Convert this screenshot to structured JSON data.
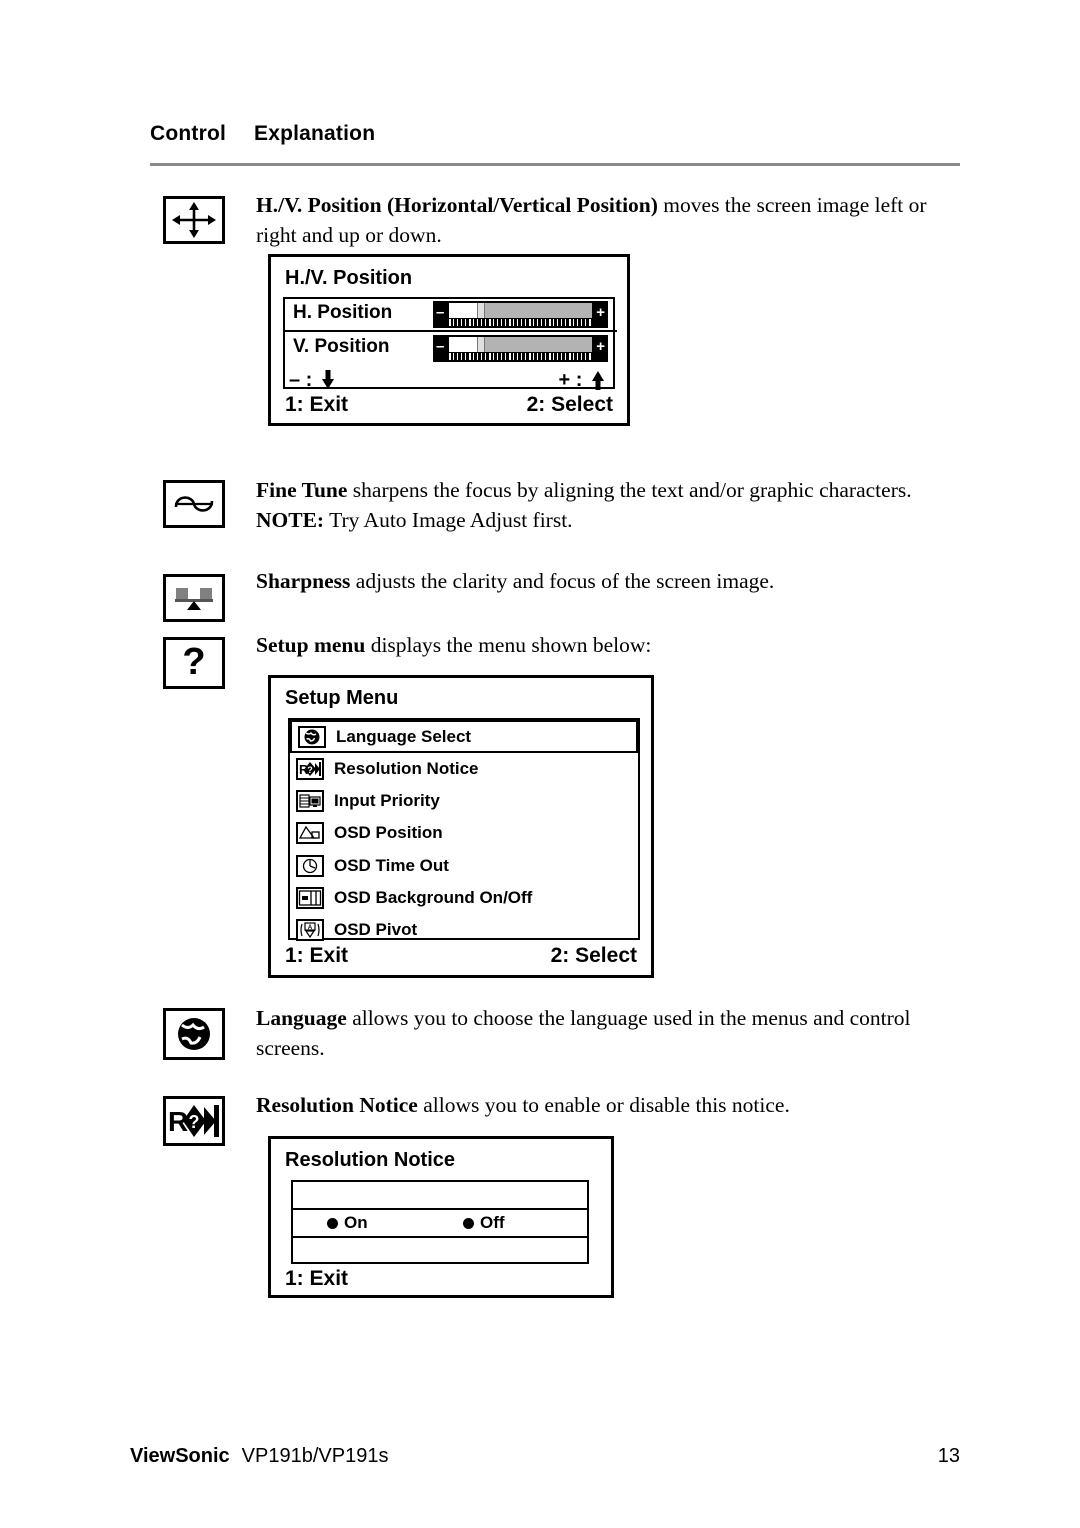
{
  "header": {
    "col_control": "Control",
    "col_explanation": "Explanation"
  },
  "controls": [
    {
      "icon": "hv-position-icon",
      "term": "H./V. Position (Horizontal/Vertical Position)",
      "description": " moves the screen image left or right and up or down."
    },
    {
      "icon": "fine-tune-icon",
      "term": "Fine Tune",
      "description": " sharpens the focus by aligning the text and/or graphic characters.",
      "note_label": "NOTE:",
      "note_text": " Try Auto Image Adjust first."
    },
    {
      "icon": "sharpness-icon",
      "term": "Sharpness",
      "description": " adjusts the clarity and focus of the screen image."
    },
    {
      "icon": "setup-menu-icon",
      "term": "Setup menu",
      "description": " displays the menu shown below:"
    },
    {
      "icon": "language-globe-icon",
      "term": "Language",
      "description": " allows you to choose the language used in the menus and control screens."
    },
    {
      "icon": "resolution-notice-icon",
      "term": "Resolution Notice",
      "description": " allows you to enable or disable this notice."
    }
  ],
  "hv_osd": {
    "title": "H./V. Position",
    "rows": [
      {
        "label": "H. Position",
        "minus": "–",
        "plus": "+",
        "fill_percent": 20,
        "thumb_percent": 20
      },
      {
        "label": "V. Position",
        "minus": "–",
        "plus": "+",
        "fill_percent": 20,
        "thumb_percent": 20
      }
    ],
    "sign_minus": "– :",
    "sign_plus": "+ :",
    "footer_left": "1: Exit",
    "footer_right": "2: Select"
  },
  "setup_osd": {
    "title": "Setup Menu",
    "items": [
      {
        "label": "Language Select",
        "icon": "globe-icon",
        "selected": true
      },
      {
        "label": "Resolution Notice",
        "icon": "resolution-notice-icon",
        "selected": false
      },
      {
        "label": "Input Priority",
        "icon": "input-priority-icon",
        "selected": false
      },
      {
        "label": "OSD Position",
        "icon": "osd-position-icon",
        "selected": false
      },
      {
        "label": "OSD Time Out",
        "icon": "clock-icon",
        "selected": false
      },
      {
        "label": "OSD Background On/Off",
        "icon": "osd-background-icon",
        "selected": false
      },
      {
        "label": "OSD Pivot",
        "icon": "osd-pivot-icon",
        "selected": false
      }
    ],
    "footer_left": "1: Exit",
    "footer_right": "2: Select"
  },
  "resolution_notice_osd": {
    "title": "Resolution Notice",
    "options": [
      {
        "label": "On"
      },
      {
        "label": "Off"
      }
    ],
    "footer_left": "1: Exit"
  },
  "footer": {
    "brand": "ViewSonic",
    "model": "VP191b/VP191s",
    "page_number": "13"
  },
  "colors": {
    "rule": "#8a8a8a",
    "slider_bg": "#000000",
    "slider_track": "#b3b3b3",
    "slider_fill": "#ffffff",
    "slider_thumb": "#e0e0e0"
  }
}
